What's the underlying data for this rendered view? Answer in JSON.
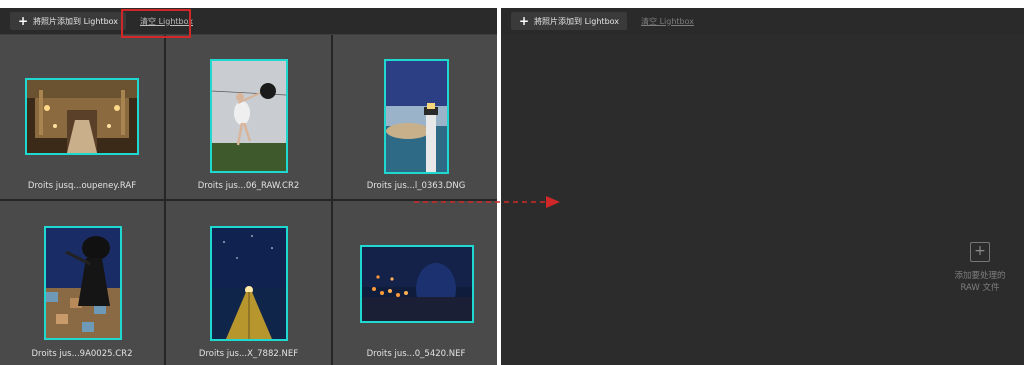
{
  "left_panel": {
    "add_button_label": "將照片添加到 Lightbox",
    "clear_button_label": "清空 Lightbox",
    "photos": [
      {
        "filename": "Droits jusq...oupeney.RAF"
      },
      {
        "filename": "Droits jus...06_RAW.CR2"
      },
      {
        "filename": "Droits jus...l_0363.DNG"
      },
      {
        "filename": "Droits jus...9A0025.CR2"
      },
      {
        "filename": "Droits jus...X_7882.NEF"
      },
      {
        "filename": "Droits jus...0_5420.NEF"
      }
    ]
  },
  "right_panel": {
    "add_button_label": "將照片添加到 Lightbox",
    "clear_button_label": "清空 Lightbox",
    "dropzone_line1": "添加要处理的",
    "dropzone_line2": "RAW 文件"
  },
  "colors": {
    "selection_border": "#1fd8cf",
    "highlight_box": "#d02828",
    "arrow": "#d02828"
  },
  "icons": [
    "plus-icon",
    "add-files-icon",
    "arrow-icon"
  ]
}
